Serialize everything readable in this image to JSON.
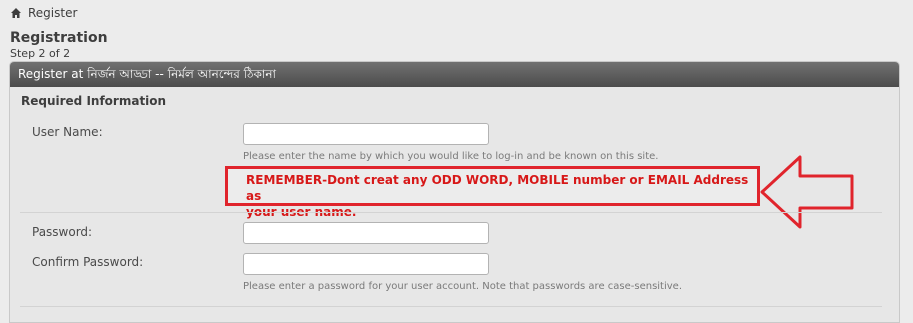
{
  "breadcrumb": {
    "home_icon": "home-icon",
    "label": "Register"
  },
  "page": {
    "title": "Registration",
    "subtitle": "Step 2 of 2"
  },
  "block": {
    "header": "Register at নির্জন আড্ডা -- নির্মল আনন্দের ঠিকানা"
  },
  "section": {
    "title": "Required Information"
  },
  "fields": {
    "username": {
      "label": "User Name:",
      "value": "",
      "placeholder": ""
    },
    "username_hint": "Please enter the name by which you would like to log-in and be known on this site.",
    "password": {
      "label": "Password:",
      "value": ""
    },
    "confirm_password": {
      "label": "Confirm Password:",
      "value": ""
    },
    "password_hint": "Please enter a password for your user account. Note that passwords are case-sensitive."
  },
  "notice": {
    "line1": "REMEMBER-Dont creat any ODD WORD, MOBILE number or EMAIL Address as",
    "line2": "your user name.",
    "color": "#d71818",
    "arrow_icon": "left-arrow-icon"
  },
  "colors": {
    "header_bg": "#5a5a5a",
    "page_bg": "#ececec",
    "notice_red": "#e0242c"
  }
}
